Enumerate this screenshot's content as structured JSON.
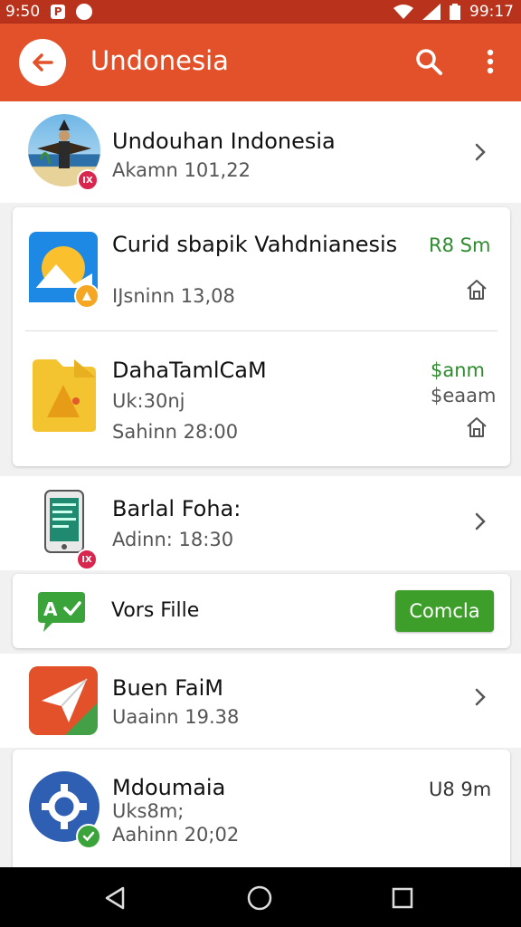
{
  "status_bar": {
    "time_left": "9:50",
    "time_right": "99:17"
  },
  "app_bar": {
    "title": "Undonesia"
  },
  "items": [
    {
      "title": "Undouhan Indonesia",
      "subtitle": "Akamn 101,22",
      "badge": "IX"
    },
    {
      "title": "Curid sbapik Vahdnianesis",
      "subtitle": "IJsninn 13,08",
      "price": "R8 Sm"
    },
    {
      "title": "DahaTamlCaM",
      "subtitle": "Uk:30nj",
      "subtitle2": "Sahinn 28:00",
      "price": "$anm",
      "price2": "$eaam"
    },
    {
      "title": "Barlal Foha:",
      "subtitle": "Adinn: 18:30",
      "badge": "IX"
    },
    {
      "title": "Vors Fille",
      "button": "Comcla"
    },
    {
      "title": "Buen FaiM",
      "subtitle": "Uaainn 19.38"
    },
    {
      "title": "Mdoumaia",
      "subtitle": "Uks8m;",
      "subtitle2": "Aahinn 20;02",
      "price": "U8 9m"
    }
  ],
  "colors": {
    "status_bar": "#b8321c",
    "app_bar": "#e2512a",
    "green_price": "#2e8b2e",
    "green_button": "#3d9e2a",
    "badge_red": "#d8264f",
    "badge_green": "#3aa33a"
  },
  "icons": [
    "back-arrow-icon",
    "search-icon",
    "more-vert-icon",
    "chevron-right-icon",
    "home-icon",
    "nav-back-icon",
    "nav-home-icon",
    "nav-recents-icon"
  ]
}
